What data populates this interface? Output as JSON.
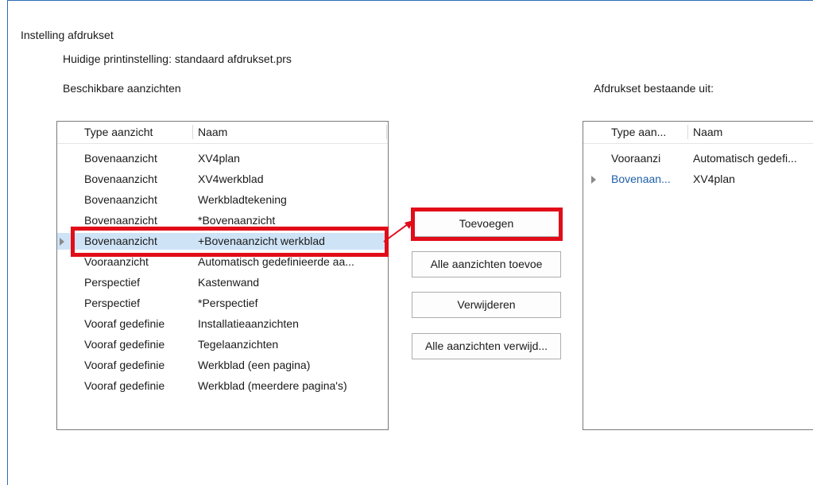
{
  "section_title": "Instelling afdrukset",
  "current_setting": "Huidige printinstelling: standaard afdrukset.prs",
  "available_label": "Beschikbare aanzichten",
  "set_label": "Afdrukset bestaande uit:",
  "available_list": {
    "columns": [
      "Type aanzicht",
      "Naam"
    ],
    "rows": [
      {
        "type": "Bovenaanzicht",
        "name": "XV4plan"
      },
      {
        "type": "Bovenaanzicht",
        "name": "XV4werkblad"
      },
      {
        "type": "Bovenaanzicht",
        "name": "Werkbladtekening"
      },
      {
        "type": "Bovenaanzicht",
        "name": "*Bovenaanzicht"
      },
      {
        "type": "Bovenaanzicht",
        "name": "+Bovenaanzicht werkblad"
      },
      {
        "type": "Vooraanzicht",
        "name": "Automatisch gedefinieerde aa..."
      },
      {
        "type": "Perspectief",
        "name": "Kastenwand"
      },
      {
        "type": "Perspectief",
        "name": "*Perspectief"
      },
      {
        "type": "Vooraf gedefinie",
        "name": "Installatieaanzichten"
      },
      {
        "type": "Vooraf gedefinie",
        "name": "Tegelaanzichten"
      },
      {
        "type": "Vooraf gedefinie",
        "name": "Werkblad (een pagina)"
      },
      {
        "type": "Vooraf gedefinie",
        "name": "Werkblad (meerdere pagina's)"
      }
    ],
    "selected_index": 4
  },
  "buttons": {
    "add": "Toevoegen",
    "add_all": "Alle aanzichten toevoe",
    "remove": "Verwijderen",
    "remove_all": "Alle aanzichten verwijd..."
  },
  "set_list": {
    "columns": [
      "Type aan...",
      "Naam"
    ],
    "rows": [
      {
        "type": "Vooraanzi",
        "name": "Automatisch gedefi..."
      },
      {
        "type": "Bovenaan...",
        "name": "XV4plan"
      }
    ],
    "current_index": 1
  },
  "colors": {
    "annotation": "#e10d19",
    "frame": "#2b6cb5",
    "selection": "#cfe3f7"
  }
}
